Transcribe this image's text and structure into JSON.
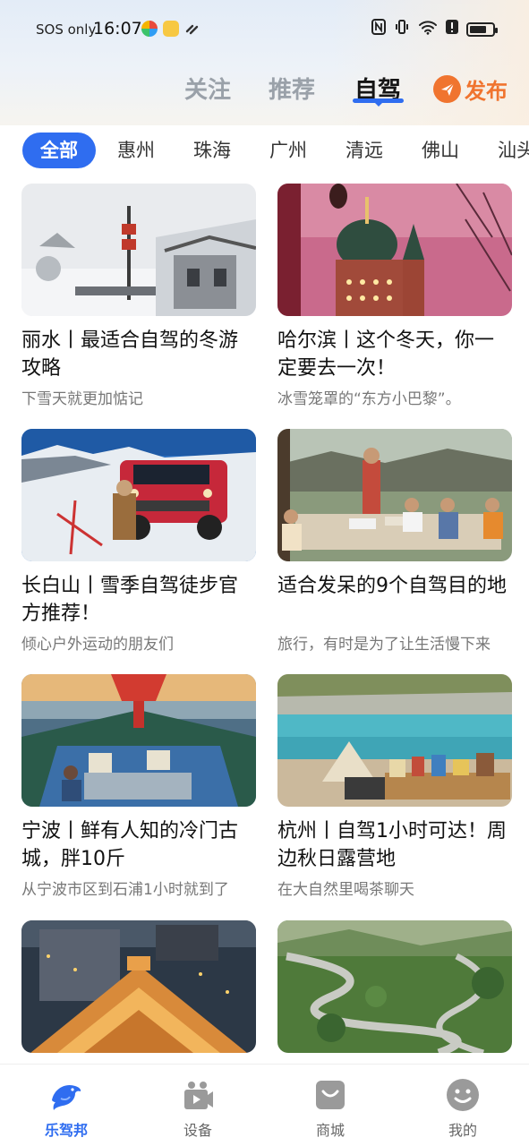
{
  "status_bar": {
    "carrier": "SOS only",
    "time": "16:07"
  },
  "main_tabs": [
    {
      "label": "关注",
      "active": false
    },
    {
      "label": "推荐",
      "active": false
    },
    {
      "label": "自驾",
      "active": true
    }
  ],
  "publish_label": "发布",
  "cities": [
    "全部",
    "惠州",
    "珠海",
    "广州",
    "清远",
    "佛山",
    "汕头"
  ],
  "cards": [
    {
      "title": "丽水丨最适合自驾的冬游攻略",
      "subtitle": "下雪天就更加惦记"
    },
    {
      "title": "哈尔滨丨这个冬天，你一定要去一次！",
      "subtitle": "冰雪笼罩的“东方小巴黎”。"
    },
    {
      "title": "长白山丨雪季自驾徒步官方推荐！",
      "subtitle": "倾心户外运动的朋友们"
    },
    {
      "title": "适合发呆的9个自驾目的地",
      "subtitle": "旅行，有时是为了让生活慢下来"
    },
    {
      "title": "宁波丨鲜有人知的冷门古城，胖10斤",
      "subtitle": "从宁波市区到石浦1小时就到了"
    },
    {
      "title": "杭州丨自驾1小时可达！周边秋日露营地",
      "subtitle": "在大自然里喝茶聊天"
    }
  ],
  "bottom_nav": [
    {
      "label": "乐驾邦",
      "icon": "dolphin-icon",
      "active": true
    },
    {
      "label": "设备",
      "icon": "device-icon",
      "active": false
    },
    {
      "label": "商城",
      "icon": "shop-bag-icon",
      "active": false
    },
    {
      "label": "我的",
      "icon": "smiley-icon",
      "active": false
    }
  ],
  "colors": {
    "accent": "#2f6df0",
    "publish": "#f0742f",
    "tab_inactive": "#9aa1a9"
  }
}
